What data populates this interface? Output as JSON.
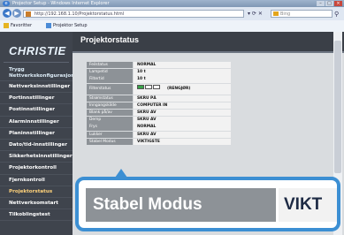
{
  "window": {
    "title": "Projector Setup - Windows Internet Explorer"
  },
  "browser": {
    "address": "http://192.168.1.10/Projektorstatus.html",
    "search_placeholder": "Bing",
    "favorites": [
      {
        "label": "Favoritter",
        "color": "#e6b422"
      },
      {
        "label": "Projektor Setup",
        "color": "#4b8bd6"
      }
    ]
  },
  "sidebar": {
    "logo": "CHRISTIE",
    "items": [
      {
        "label": "Trygg",
        "label2": "Nettverkskonfigurasjon",
        "two": true
      },
      {
        "label": "Nettverksinnstillinger"
      },
      {
        "label": "Portinnstillinger"
      },
      {
        "label": "Postinnstillinger"
      },
      {
        "label": "Alarminnstillinger"
      },
      {
        "label": "Planinnstillinger"
      },
      {
        "label": "Dato/tid-innstillinger"
      },
      {
        "label": "Sikkerhetsinnstillinger"
      },
      {
        "label": "Projektorkontroll"
      },
      {
        "label": "Fjernkontroll"
      },
      {
        "label": "Projektorstatus",
        "active": true
      },
      {
        "label": "Nettverksomstart"
      },
      {
        "label": "Tilkoblingstest"
      }
    ]
  },
  "main": {
    "title": "Projektorstatus",
    "rows": [
      {
        "label": "Feilstatus",
        "value": "NORMAL"
      },
      {
        "label": "Lampetid",
        "value": "10 t"
      },
      {
        "label": "Filtertid",
        "value": "10 t"
      },
      {
        "label": "Filterstatus",
        "value": "(RENGJØR)",
        "filter": true
      },
      {
        "label": "Strømstatus",
        "value": "SKRU PÅ"
      },
      {
        "label": "Inngangskilde",
        "value": "COMPUTER IN"
      },
      {
        "label": "Blank på/av",
        "value": "SKRU AV"
      },
      {
        "label": "Demp",
        "value": "SKRU AV"
      },
      {
        "label": "Frys",
        "value": "NORMAL"
      },
      {
        "label": "Lukker",
        "value": "SKRU AV"
      },
      {
        "label": "Stabel Modus",
        "value": "VIKTIGSTE"
      }
    ],
    "filter_level": 0.33
  },
  "zoom": {
    "label": "Stabel Modus",
    "value": "VIKT"
  },
  "colors": {
    "accent": "#3c8fd3",
    "sidebar": "#3f444d",
    "label_bg": "#8d9297"
  }
}
